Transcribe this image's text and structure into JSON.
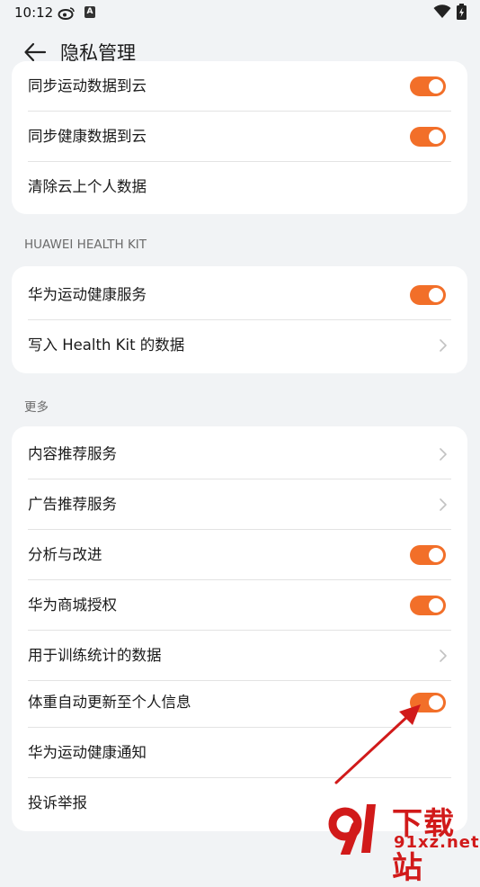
{
  "status_bar": {
    "time": "10:12",
    "notification_badge": "A"
  },
  "header": {
    "title": "隐私管理"
  },
  "cloud_card": {
    "items": [
      {
        "label": "同步运动数据到云",
        "control": "toggle",
        "on": true
      },
      {
        "label": "同步健康数据到云",
        "control": "toggle",
        "on": true
      },
      {
        "label": "清除云上个人数据",
        "control": "none"
      }
    ]
  },
  "health_kit": {
    "section_title": "HUAWEI HEALTH KIT",
    "items": [
      {
        "label": "华为运动健康服务",
        "control": "toggle",
        "on": true
      },
      {
        "label": "写入 Health Kit 的数据",
        "control": "chevron"
      }
    ]
  },
  "more": {
    "section_title": "更多",
    "items": [
      {
        "label": "内容推荐服务",
        "control": "chevron"
      },
      {
        "label": "广告推荐服务",
        "control": "chevron"
      },
      {
        "label": "分析与改进",
        "control": "toggle",
        "on": true
      },
      {
        "label": "华为商城授权",
        "control": "toggle",
        "on": true
      },
      {
        "label": "用于训练统计的数据",
        "control": "chevron"
      },
      {
        "label": "体重自动更新至个人信息",
        "control": "toggle",
        "on": true
      },
      {
        "label": "华为运动健康通知",
        "control": "none"
      },
      {
        "label": "投诉举报",
        "control": "none"
      }
    ]
  },
  "colors": {
    "accent": "#f26f29",
    "annotation_arrow": "#d11a1a"
  },
  "watermark": {
    "title": "下载站",
    "url": "91xz.net"
  }
}
